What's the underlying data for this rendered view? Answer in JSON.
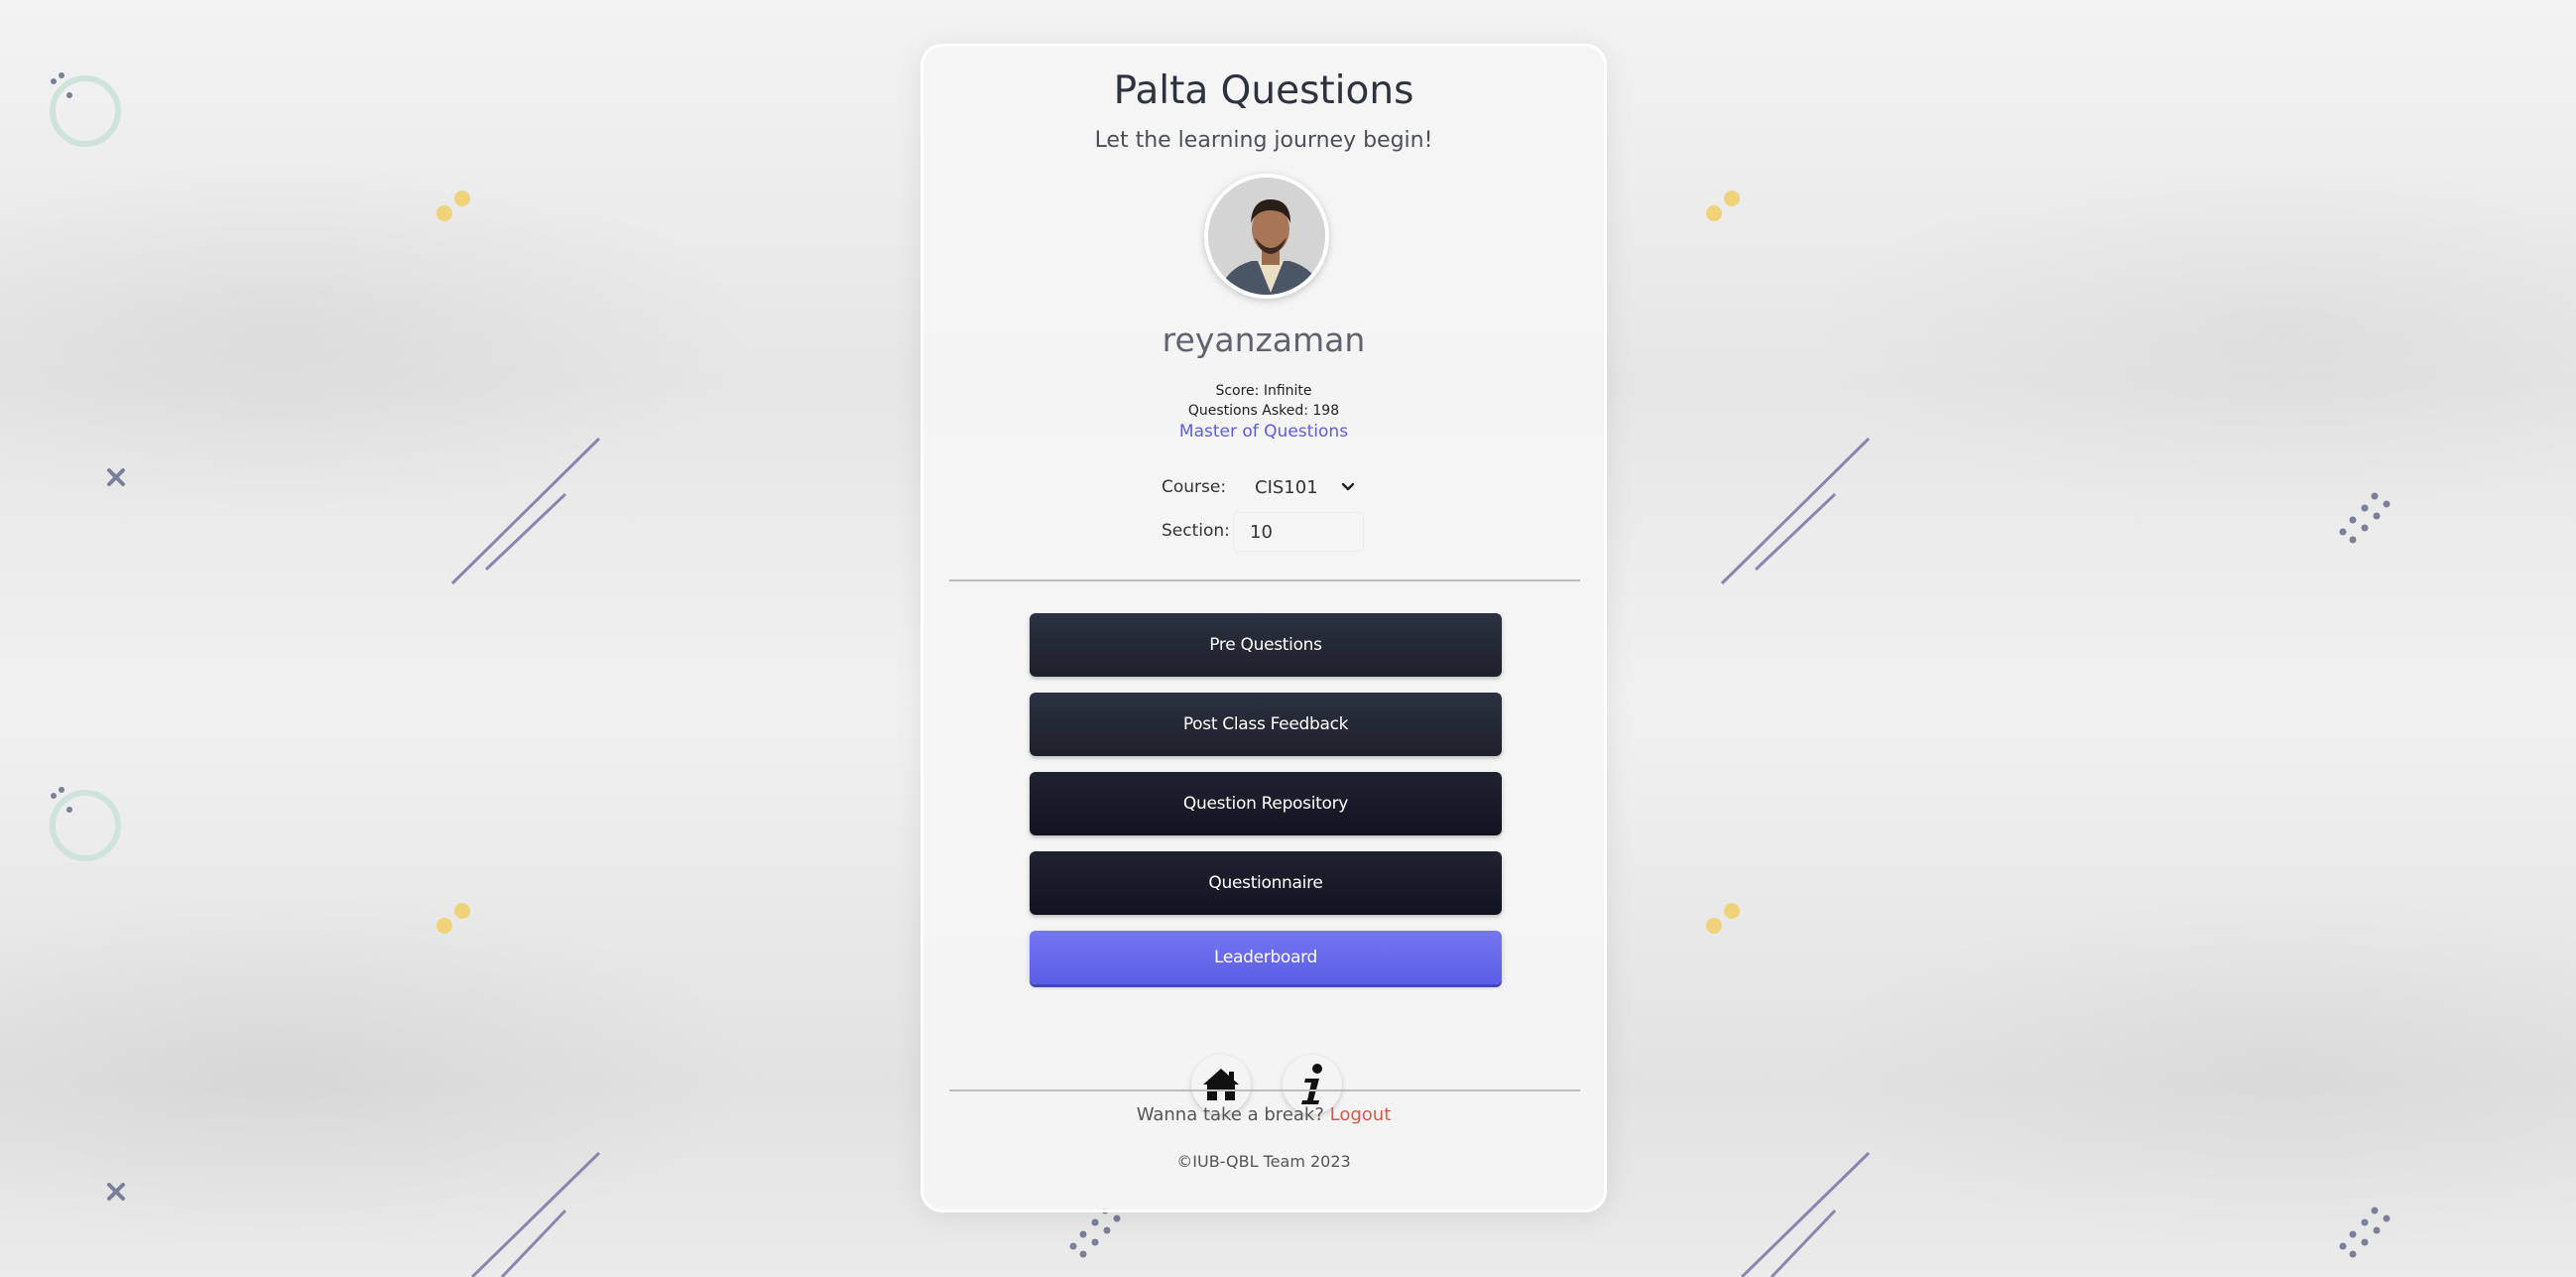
{
  "app": {
    "title": "Palta Questions",
    "subtitle": "Let the learning journey begin!"
  },
  "profile": {
    "username": "reyanzaman",
    "score_text": "Score: Infinite",
    "questions_asked_text": "Questions Asked: 198",
    "rank": "Master of Questions"
  },
  "form": {
    "course_label": "Course:",
    "course_value": "CIS101",
    "section_label": "Section:",
    "section_value": "10"
  },
  "menu": {
    "pre_questions": "Pre Questions",
    "post_class_feedback": "Post Class Feedback",
    "question_repository": "Question Repository",
    "questionnaire": "Questionnaire",
    "leaderboard": "Leaderboard"
  },
  "icons": {
    "home": "home-icon",
    "info": "info-icon"
  },
  "footer": {
    "break_text": "Wanna take a break?",
    "logout_label": "Logout",
    "copyright": "©IUB-QBL Team 2023"
  },
  "colors": {
    "accent": "#5b5ce6",
    "dark_button": "#1d212c",
    "logout": "#e05548"
  }
}
